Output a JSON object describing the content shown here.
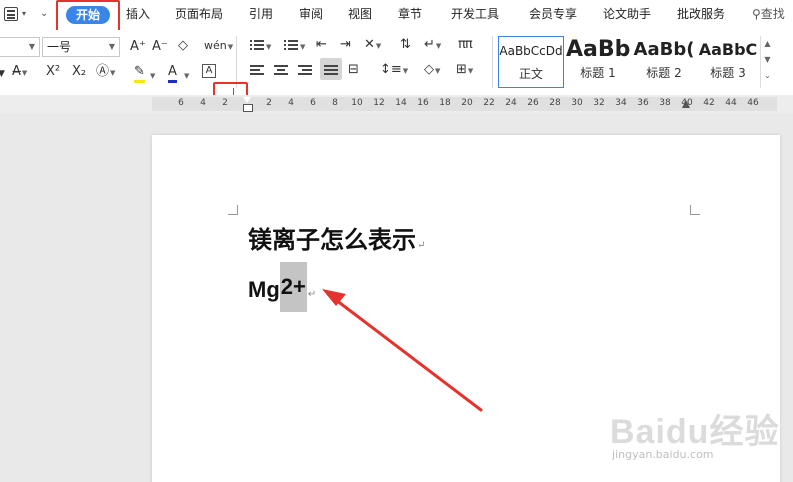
{
  "menu": {
    "items": [
      {
        "label": "插入"
      },
      {
        "label": "页面布局"
      },
      {
        "label": "引用"
      },
      {
        "label": "审阅"
      },
      {
        "label": "视图"
      },
      {
        "label": "章节"
      },
      {
        "label": "开发工具"
      },
      {
        "label": "会员专享"
      },
      {
        "label": "论文助手"
      },
      {
        "label": "批改服务"
      }
    ],
    "active_tab": "开始",
    "search_label": "查找"
  },
  "ribbon": {
    "font_size_value": "一号",
    "font_name_value": "",
    "buttons": {
      "grow_font": "A⁺",
      "shrink_font": "A⁻",
      "clear_format": "◇",
      "pinyin": "wén",
      "superscript": "X²",
      "subscript": "X₂",
      "highlight": "A",
      "font_color": "A",
      "char_border": "A"
    },
    "styles": [
      {
        "preview": "AaBbCcDd",
        "name": "正文"
      },
      {
        "preview": "AaBb",
        "name": "标题 1"
      },
      {
        "preview": "AaBb(",
        "name": "标题 2"
      },
      {
        "preview": "AaBbC",
        "name": "标题 3"
      }
    ]
  },
  "ruler": {
    "ticks": [
      "6",
      "4",
      "2",
      "2",
      "4",
      "6",
      "8",
      "10",
      "12",
      "14",
      "16",
      "18",
      "20",
      "22",
      "24",
      "26",
      "28",
      "30",
      "32",
      "34",
      "36",
      "38",
      "40",
      "42",
      "44",
      "46"
    ]
  },
  "document": {
    "line1": "镁离子怎么表示",
    "line2_prefix": "Mg",
    "line2_selected": "2+",
    "para_mark": "↵"
  },
  "watermark": {
    "brand": "Baidu经验",
    "url": "jingyan.baidu.com"
  },
  "colors": {
    "accent": "#3a86e8",
    "annotation": "#e5322d",
    "selection": "#c4c4c4"
  }
}
